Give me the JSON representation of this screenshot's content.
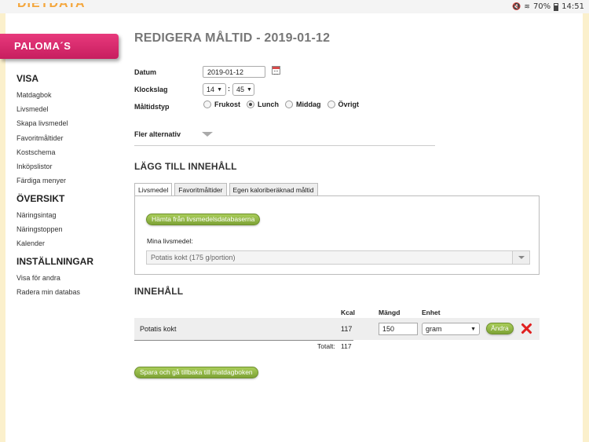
{
  "statusbar": {
    "logo_fragment": "DIETDATA",
    "battery": "70%",
    "time": "14:51"
  },
  "sidebar": {
    "brand": "PALOMA´S",
    "sections": [
      {
        "heading": "VISA",
        "items": [
          "Matdagbok",
          "Livsmedel",
          "Skapa livsmedel",
          "Favoritmåltider",
          "Kostschema",
          "Inköpslistor",
          "Färdiga menyer"
        ]
      },
      {
        "heading": "ÖVERSIKT",
        "items": [
          "Näringsintag",
          "Näringstoppen",
          "Kalender"
        ]
      },
      {
        "heading": "INSTÄLLNINGAR",
        "items": [
          "Visa för andra",
          "Radera min databas"
        ]
      }
    ]
  },
  "page": {
    "title": "REDIGERA MÅLTID - 2019-01-12"
  },
  "form": {
    "date_label": "Datum",
    "date_value": "2019-01-12",
    "time_label": "Klockslag",
    "hour": "14",
    "minute": "45",
    "colon": ":",
    "mealtype_label": "Måltidstyp",
    "meal_types": [
      "Frukost",
      "Lunch",
      "Middag",
      "Övrigt"
    ],
    "selected_meal_type": "Lunch",
    "more_options": "Fler alternativ"
  },
  "add_content": {
    "title": "LÄGG TILL INNEHÅLL",
    "tabs": [
      "Livsmedel",
      "Favoritmåltider",
      "Egen kaloriberäknad måltid"
    ],
    "active_tab": "Livsmedel",
    "fetch_button": "Hämta från livsmedelsdatabaserna",
    "my_foods_label": "Mina livsmedel:",
    "my_foods_selected": "Potatis kokt (175 g/portion)"
  },
  "content": {
    "title": "INNEHÅLL",
    "columns": {
      "kcal": "Kcal",
      "amount": "Mängd",
      "unit": "Enhet"
    },
    "rows": [
      {
        "name": "Potatis kokt",
        "kcal": "117",
        "amount": "150",
        "unit": "gram",
        "change_label": "Ändra"
      }
    ],
    "total_label": "Totalt:",
    "total_value": "117"
  },
  "save_button": "Spara och gå tillbaka till matdagboken",
  "colors": {
    "brand": "#d6286b",
    "button_green": "#8db444",
    "delete_red": "#e02020",
    "frame_cream": "#fbf0cc"
  }
}
